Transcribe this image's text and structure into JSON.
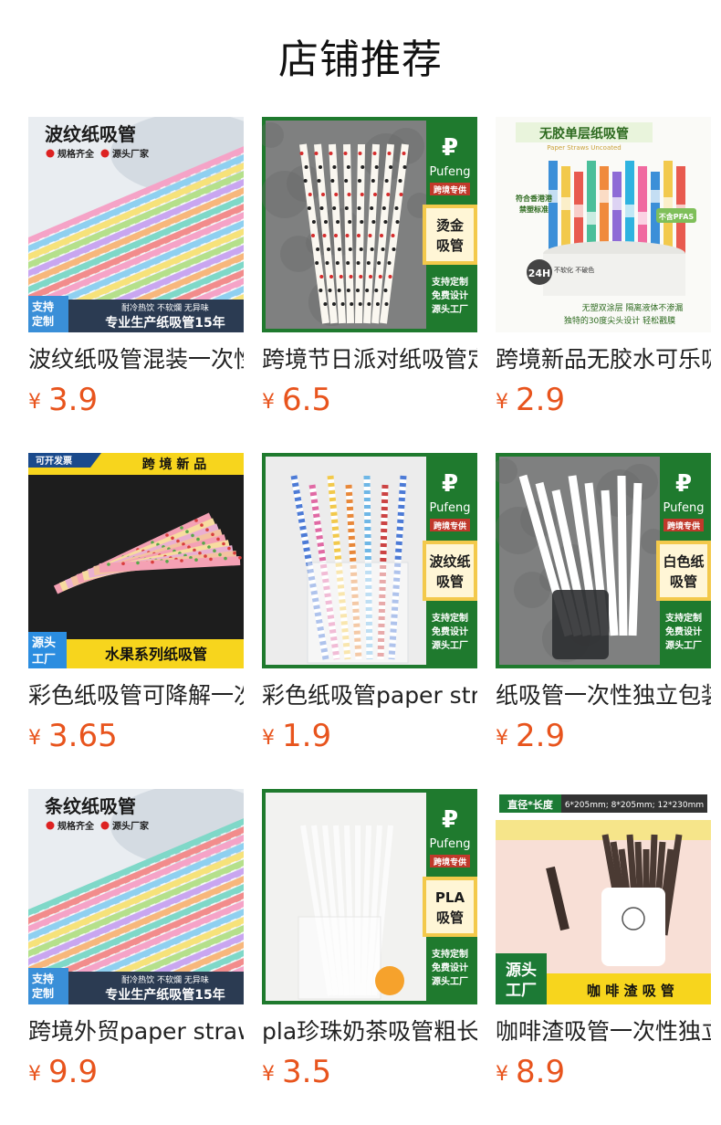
{
  "header": {
    "title": "店铺推荐"
  },
  "currency_symbol": "¥",
  "products": [
    {
      "name": "波纹纸吸管混装一次性",
      "price": "3.9",
      "image": {
        "kind": "stripes",
        "heading": "波纹纸吸管",
        "tag1": "规格齐全",
        "tag2": "源头厂家",
        "corner": "支持定制",
        "banner": "专业生产纸吸管15年",
        "small": "耐冷热饮 不软爛 无异味"
      }
    },
    {
      "name": "跨境节日派对纸吸管定制",
      "price": "6.5",
      "image": {
        "kind": "pufeng",
        "brand": "Pufeng",
        "brand_tag": "跨境专供",
        "panel": "烫金吸管",
        "lines": [
          "支持定制",
          "免费设计",
          "源头工厂"
        ],
        "straw": "dots"
      }
    },
    {
      "name": "跨境新品无胶水可乐吸管",
      "price": "2.9",
      "image": {
        "kind": "nofree",
        "heading": "无胶单层纸吸管",
        "subheading": "Paper Straws Uncoated",
        "badge": "不含PFAS",
        "side": "符合香港港禁塑标准",
        "hours": "24H",
        "hours_note": "不软化 不破色",
        "foot1": "无塑双涂层 隔离液体不渗漏",
        "foot2": "独特的30度尖头设计 轻松戳膜"
      }
    },
    {
      "name": "彩色纸吸管可降解一次性",
      "price": "3.65",
      "image": {
        "kind": "fruit",
        "topleft": "可开发票",
        "topright": "跨境新品",
        "corner": "源头工厂",
        "banner": "水果系列纸吸管"
      }
    },
    {
      "name": "彩色纸吸管paper straws",
      "price": "1.9",
      "image": {
        "kind": "pufeng",
        "brand": "Pufeng",
        "brand_tag": "跨境专供",
        "panel": "波纹纸吸管",
        "lines": [
          "支持定制",
          "免费设计",
          "源头工厂"
        ],
        "straw": "chevron"
      }
    },
    {
      "name": "纸吸管一次性独立包装",
      "price": "2.9",
      "image": {
        "kind": "pufeng",
        "brand": "Pufeng",
        "brand_tag": "跨境专供",
        "panel": "白色纸吸管",
        "lines": [
          "支持定制",
          "免费设计",
          "源头工厂"
        ],
        "straw": "white-dark"
      }
    },
    {
      "name": "跨境外贸paper straws",
      "price": "9.9",
      "image": {
        "kind": "stripes",
        "heading": "条纹纸吸管",
        "tag1": "规格齐全",
        "tag2": "源头厂家",
        "corner": "支持定制",
        "banner": "专业生产纸吸管15年",
        "small": "耐冷热饮 不软爛 无异味"
      }
    },
    {
      "name": "pla珍珠奶茶吸管粗长",
      "price": "3.5",
      "image": {
        "kind": "pufeng",
        "brand": "Pufeng",
        "brand_tag": "跨境专供",
        "panel": "PLA吸管",
        "lines": [
          "支持定制",
          "免费设计",
          "源头工厂"
        ],
        "straw": "white-glass"
      }
    },
    {
      "name": "咖啡渣吸管一次性独立包装",
      "price": "8.9",
      "image": {
        "kind": "coffee",
        "spec_label": "直径*长度",
        "spec": "6*205mm; 8*205mm; 12*230mm",
        "corner": "源头工厂",
        "banner": "咖啡渣吸管"
      }
    }
  ],
  "colors": {
    "price": "#e8541d",
    "brand_green": "#1f7a2e",
    "panel_gold": "#f3c94b"
  }
}
